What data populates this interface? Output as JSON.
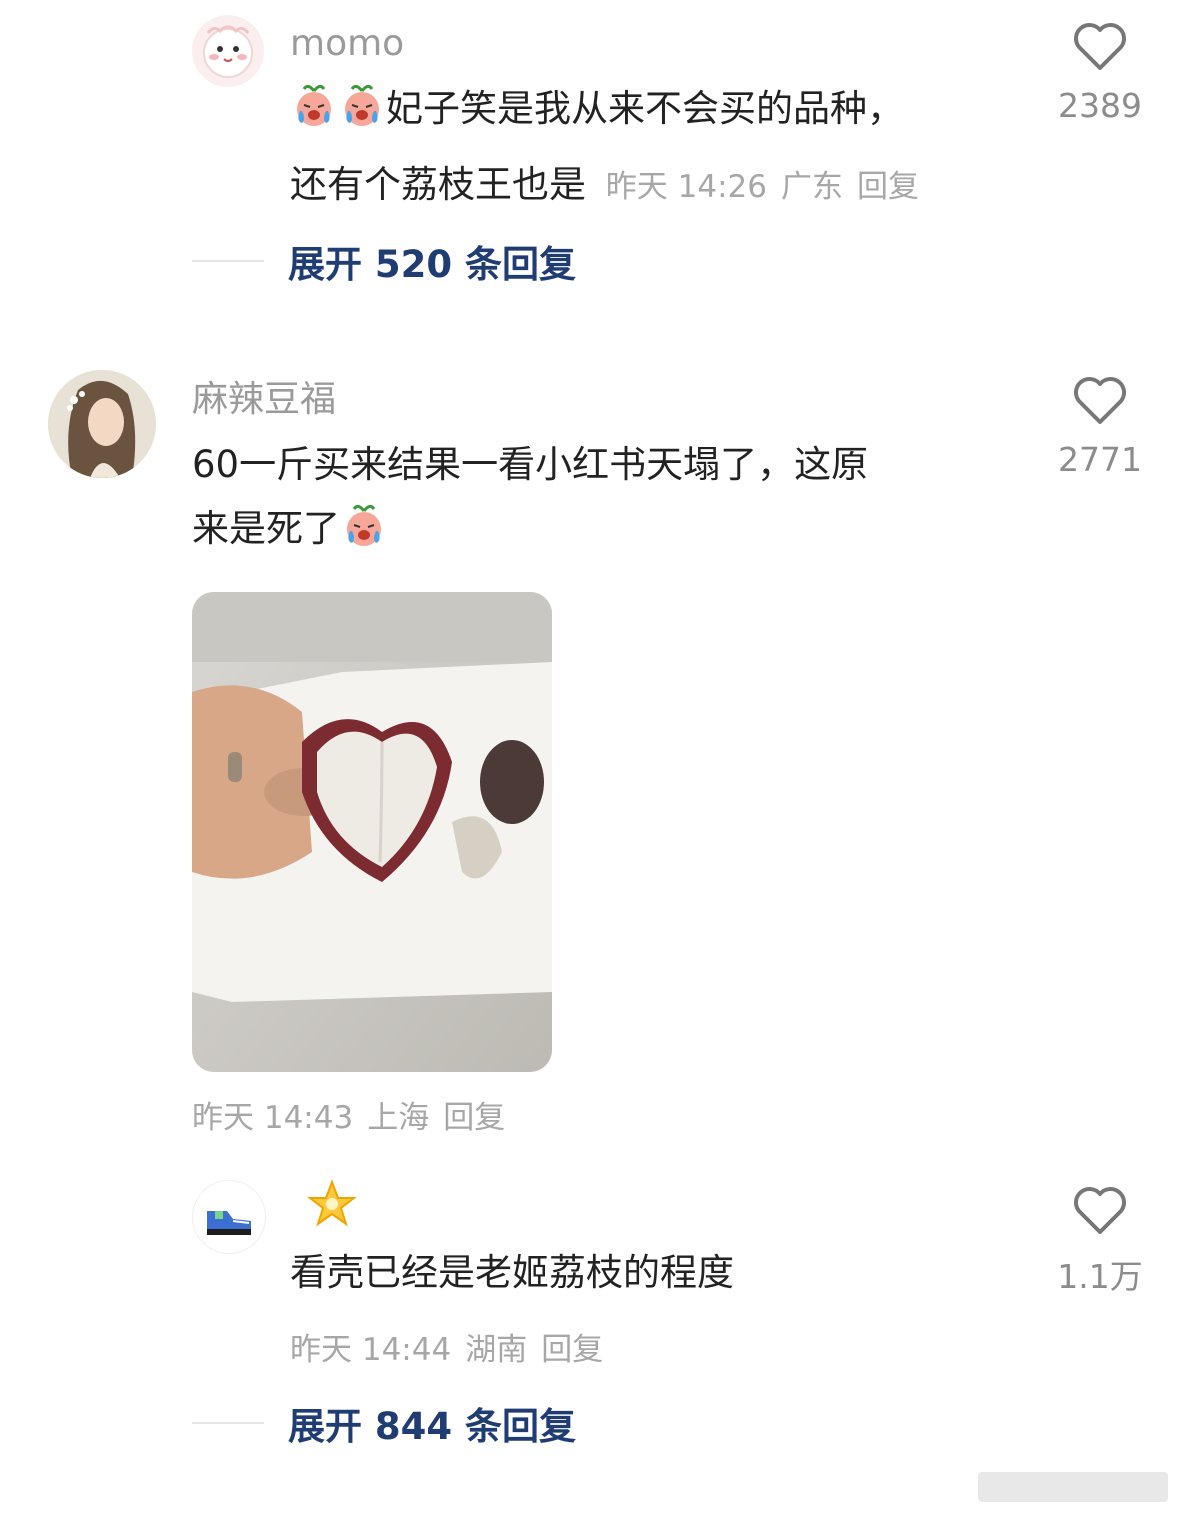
{
  "comments": [
    {
      "username": "momo",
      "text_line1": "妃子笑是我从来不会买的品种，",
      "text_line2": "还有个荔枝王也是",
      "time": "昨天 14:26",
      "location": "广东",
      "reply_label": "回复",
      "likes": "2389",
      "expand_label": "展开 520 条回复"
    },
    {
      "username": "麻辣豆福",
      "text_line1": "60一斤买来结果一看小红书天塌了，这原",
      "text_line2": "来是死了",
      "time": "昨天 14:43",
      "location": "上海",
      "reply_label": "回复",
      "likes": "2771"
    },
    {
      "username": "",
      "text": "看壳已经是老姬荔枝的程度",
      "time": "昨天 14:44",
      "location": "湖南",
      "reply_label": "回复",
      "likes": "1.1万",
      "expand_label": "展开 844 条回复"
    }
  ],
  "icons": {
    "like": "heart-outline-icon",
    "cry_emoji": "crying-peach-emoji",
    "star_emoji": "glowing-star-emoji"
  },
  "colors": {
    "username": "#9a9a9a",
    "meta": "#a7a7a7",
    "expand": "#1f3d73",
    "text": "#222222"
  }
}
